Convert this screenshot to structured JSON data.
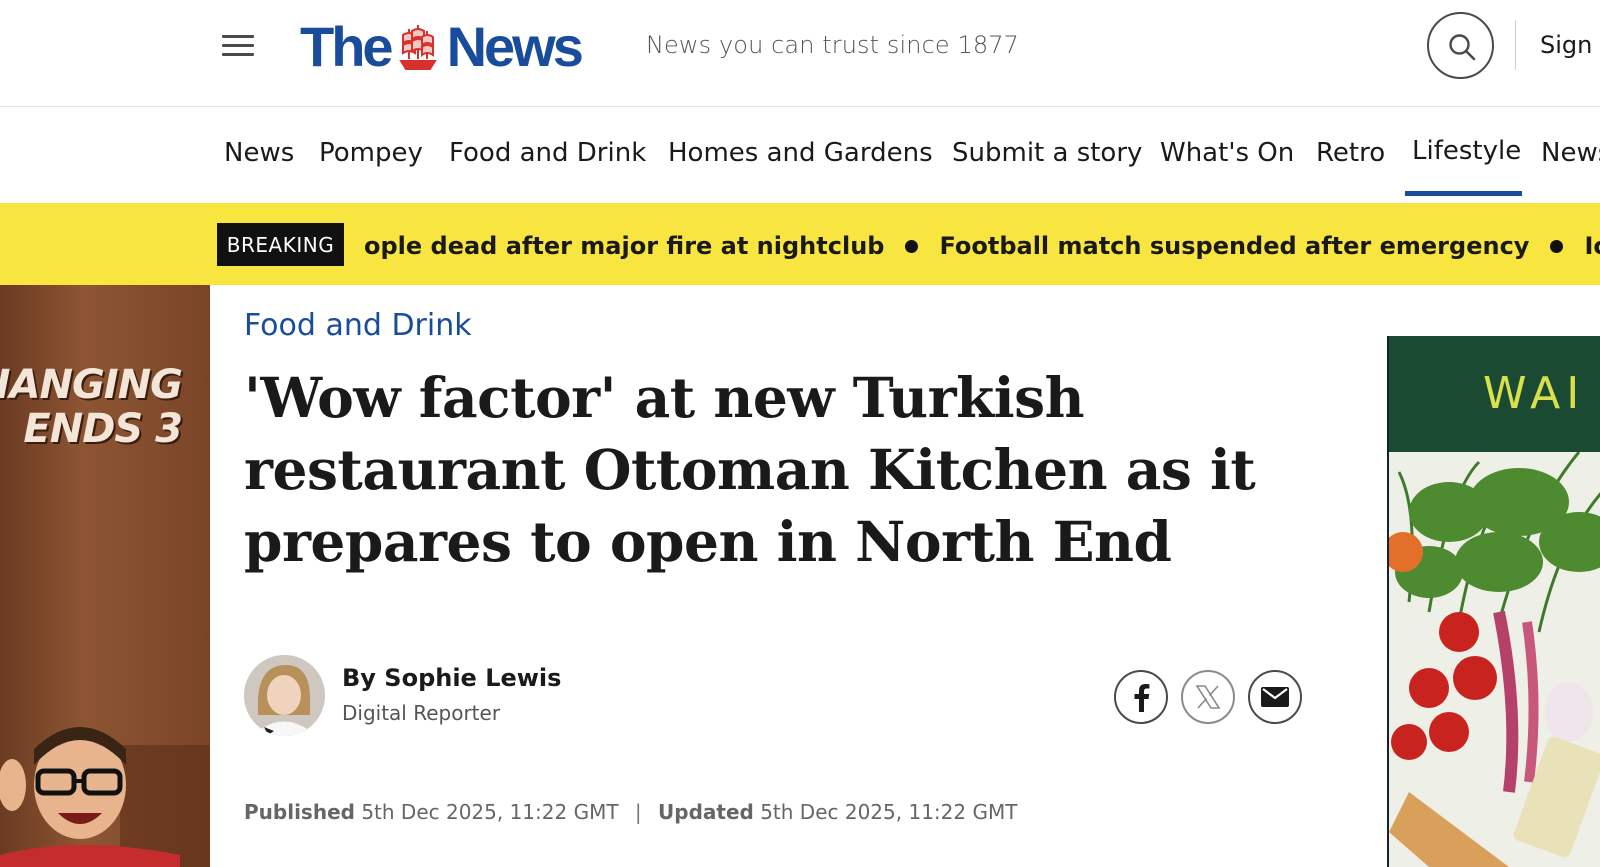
{
  "header": {
    "logo_left": "The",
    "logo_right": "News",
    "tagline": "News you can trust since 1877",
    "sign_in": "Sign I"
  },
  "nav": {
    "items": [
      {
        "label": "News"
      },
      {
        "label": "Pompey"
      },
      {
        "label": "Food and Drink"
      },
      {
        "label": "Homes and Gardens"
      },
      {
        "label": "Submit a story"
      },
      {
        "label": "What's On"
      },
      {
        "label": "Retro"
      },
      {
        "label": "Lifestyle",
        "active": true
      },
      {
        "label": "News"
      }
    ]
  },
  "breaking": {
    "label": "BREAKING",
    "items": [
      "ople dead after major fire at nightclub",
      "Football match suspended after emergency",
      "Iconic singer dies"
    ]
  },
  "left_ad": {
    "title_line1": "IANGING",
    "title_line2": "ENDS 3"
  },
  "article": {
    "section": "Food and Drink",
    "headline": "'Wow factor' at new Turkish restaurant Ottoman Kitchen as it prepares to open in North End",
    "author": {
      "name": "By Sophie Lewis",
      "role": "Digital Reporter"
    },
    "published_label": "Published",
    "published": "5th Dec 2025, 11:22 GMT",
    "separator": "|",
    "updated_label": "Updated",
    "updated": "5th Dec 2025, 11:22 GMT"
  },
  "share": {
    "icons": [
      "facebook-icon",
      "x-icon",
      "email-icon"
    ]
  },
  "right_ad": {
    "brand": "WAI"
  },
  "colors": {
    "brand_blue": "#1a4c9c",
    "breaking_yellow": "#f8e53f",
    "ad_green": "#1b4a33"
  }
}
